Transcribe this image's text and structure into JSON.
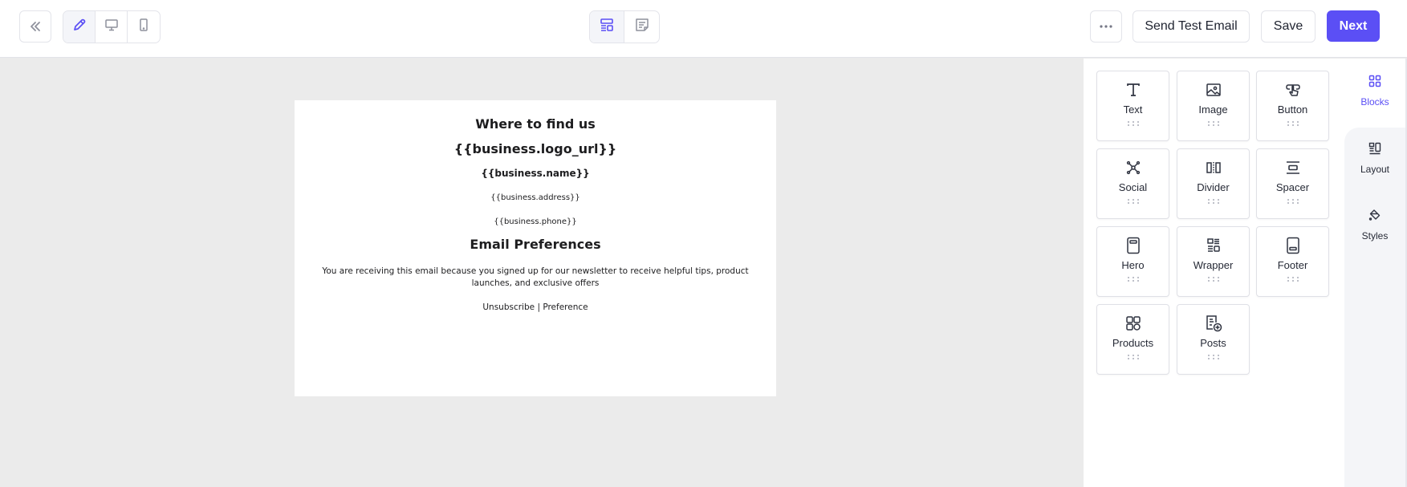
{
  "header": {
    "back_icon": "double-chevron-left-icon",
    "mode_toggle": [
      {
        "name": "edit",
        "icon": "pencil-icon",
        "active": true
      },
      {
        "name": "desktop-preview",
        "icon": "monitor-icon",
        "active": false
      },
      {
        "name": "mobile-preview",
        "icon": "smartphone-icon",
        "active": false
      }
    ],
    "view_toggle": [
      {
        "name": "visual-builder",
        "icon": "layout-icon",
        "active": true
      },
      {
        "name": "code-editor",
        "icon": "note-icon",
        "active": false
      }
    ],
    "more_icon": "ellipsis-icon",
    "send_test_label": "Send Test Email",
    "save_label": "Save",
    "next_label": "Next",
    "accent_color": "#5b4ff5"
  },
  "email": {
    "heading": "Where to find us",
    "logo_placeholder": "{{business.logo_url}}",
    "name_placeholder": "{{business.name}}",
    "address_placeholder": "{{business.address}}",
    "phone_placeholder": "{{business.phone}}",
    "preferences_heading": "Email Preferences",
    "disclaimer": "You are receiving this email because you signed up for our newsletter to receive helpful tips, product launches, and exclusive offers",
    "unsubscribe_label": "Unsubscribe",
    "separator": "|",
    "preference_label": "Preference"
  },
  "blocks": [
    {
      "label": "Text",
      "icon": "text-t-icon"
    },
    {
      "label": "Image",
      "icon": "image-icon"
    },
    {
      "label": "Button",
      "icon": "button-click-icon"
    },
    {
      "label": "Social",
      "icon": "social-network-icon"
    },
    {
      "label": "Divider",
      "icon": "divider-icon"
    },
    {
      "label": "Spacer",
      "icon": "spacer-icon"
    },
    {
      "label": "Hero",
      "icon": "hero-icon"
    },
    {
      "label": "Wrapper",
      "icon": "wrapper-icon"
    },
    {
      "label": "Footer",
      "icon": "footer-icon"
    },
    {
      "label": "Products",
      "icon": "products-grid-icon"
    },
    {
      "label": "Posts",
      "icon": "posts-add-icon"
    }
  ],
  "side_tabs": [
    {
      "label": "Blocks",
      "icon": "blocks-grid-icon",
      "active": true
    },
    {
      "label": "Layout",
      "icon": "layout-columns-icon",
      "active": false
    },
    {
      "label": "Styles",
      "icon": "paint-bucket-icon",
      "active": false
    }
  ]
}
